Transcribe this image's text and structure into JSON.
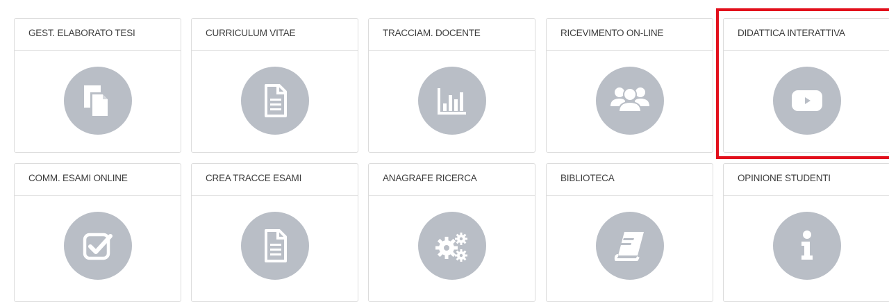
{
  "tiles": [
    {
      "label": "GEST. ELABORATO TESI",
      "icon": "copy-document-icon"
    },
    {
      "label": "CURRICULUM VITAE",
      "icon": "document-icon"
    },
    {
      "label": "TRACCIAM. DOCENTE",
      "icon": "bar-chart-icon"
    },
    {
      "label": "RICEVIMENTO ON-LINE",
      "icon": "users-group-icon"
    },
    {
      "label": "DIDATTICA INTERATTIVA",
      "icon": "play-video-icon"
    },
    {
      "label": "COMM. ESAMI ONLINE",
      "icon": "checkbox-icon"
    },
    {
      "label": "CREA TRACCE ESAMI",
      "icon": "document-icon"
    },
    {
      "label": "ANAGRAFE RICERCA",
      "icon": "gears-icon"
    },
    {
      "label": "BIBLIOTECA",
      "icon": "book-icon"
    },
    {
      "label": "OPINIONE STUDENTI",
      "icon": "info-icon"
    }
  ],
  "highlight": {
    "tile": "DIDATTICA INTERATTIVA",
    "color": "#e2101c"
  },
  "colors": {
    "icon_circle": "#b9bec6",
    "icon_glyph": "#ffffff"
  }
}
